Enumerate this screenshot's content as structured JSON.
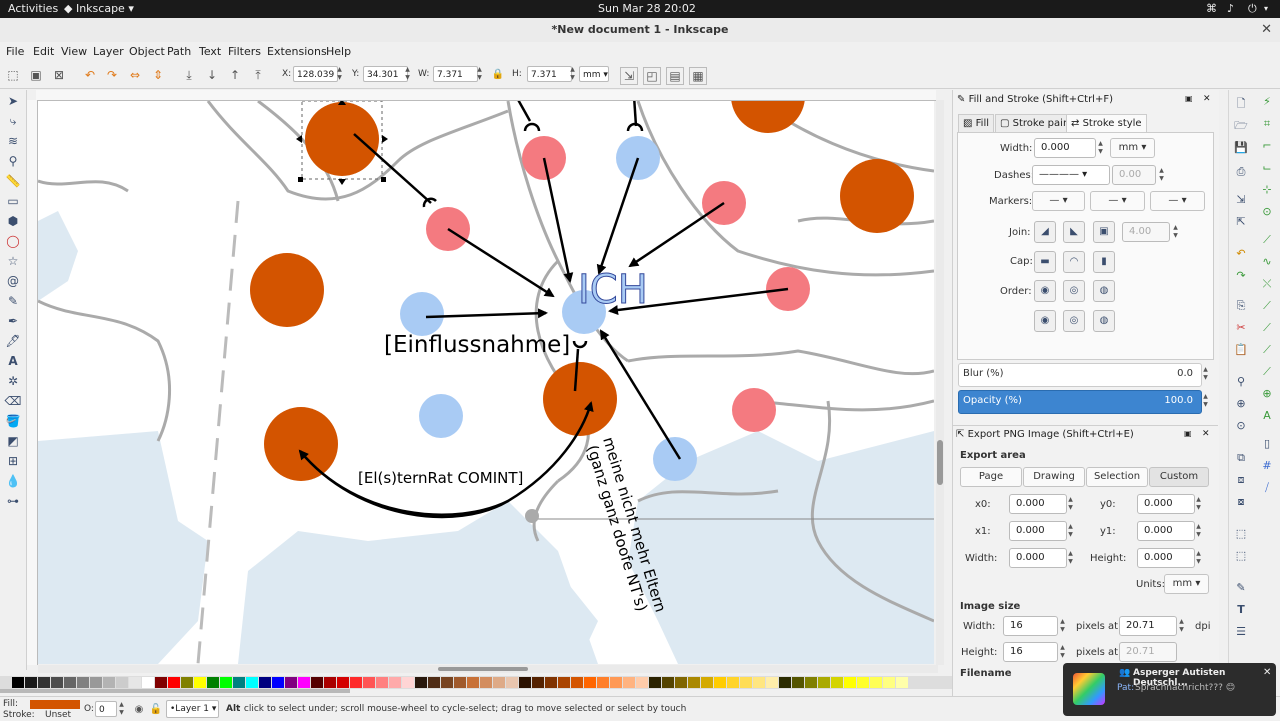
{
  "system": {
    "activities": "Activities",
    "app": "Inkscape",
    "clock": "Sun Mar 28  20:02"
  },
  "window": {
    "title": "*New document 1 - Inkscape"
  },
  "menu": [
    "File",
    "Edit",
    "View",
    "Layer",
    "Object",
    "Path",
    "Text",
    "Filters",
    "Extensions",
    "Help"
  ],
  "controls": {
    "x_label": "X:",
    "x_value": "128.039",
    "y_label": "Y:",
    "y_value": "34.301",
    "w_label": "W:",
    "w_value": "7.371",
    "h_label": "H:",
    "h_value": "7.371",
    "unit": "mm"
  },
  "canvas": {
    "text_ich": "ICH",
    "text_einfluss": "[Einflussnahme]",
    "text_comint": "[El(s)ternRat COMINT]",
    "text_eltern_1": "meine nicht mehr Eltern",
    "text_eltern_2": "(ganz ganz doofe NT's)",
    "colors": {
      "orange": "#d35400",
      "red": "#f47a80",
      "blue": "#a9cbf4",
      "sea": "#dde9f2",
      "land": "#ffffff",
      "border": "#aaaaaa"
    }
  },
  "fill_stroke": {
    "title": "Fill and Stroke (Shift+Ctrl+F)",
    "tabs": [
      "Fill",
      "Stroke paint",
      "Stroke style"
    ],
    "width_label": "Width:",
    "width_value": "0.000",
    "width_unit": "mm",
    "dashes_label": "Dashes:",
    "dashes_value": "0.00",
    "markers_label": "Markers:",
    "join_label": "Join:",
    "join_value": "4.00",
    "cap_label": "Cap:",
    "order_label": "Order:",
    "blur_label": "Blur (%)",
    "blur_value": "0.0",
    "opacity_label": "Opacity (%)",
    "opacity_value": "100.0"
  },
  "export": {
    "title": "Export PNG Image (Shift+Ctrl+E)",
    "area_heading": "Export area",
    "area_buttons": [
      "Page",
      "Drawing",
      "Selection",
      "Custom"
    ],
    "x0_label": "x0:",
    "x0_value": "0.000",
    "y0_label": "y0:",
    "y0_value": "0.000",
    "x1_label": "x1:",
    "x1_value": "0.000",
    "y1_label": "y1:",
    "y1_value": "0.000",
    "width_label": "Width:",
    "width_value": "0.000",
    "height_label": "Height:",
    "height_value": "0.000",
    "units_label": "Units:",
    "units_value": "mm",
    "image_heading": "Image size",
    "img_width_label": "Width:",
    "img_width_value": "16",
    "img_height_label": "Height:",
    "img_height_value": "16",
    "pixels_at": "pixels at",
    "dpi_value": "20.71",
    "dpi_value2": "20.71",
    "dpi": "dpi",
    "filename_label": "Filename"
  },
  "status": {
    "fill_label": "Fill:",
    "stroke_label": "Stroke:",
    "stroke_value": "Unset",
    "opacity_label": "O:",
    "opacity_value": "0",
    "layer": "•Layer 1",
    "message_bold": "Alt",
    "message": ": click to select under; scroll mouse-wheel to cycle-select; drag to move selected or select by touch",
    "fill_color": "#d35400"
  },
  "notification": {
    "title": "Asperger Autisten Deutschl...",
    "sender": "Pat:",
    "text": "Sprachnachricht??? 😊"
  }
}
